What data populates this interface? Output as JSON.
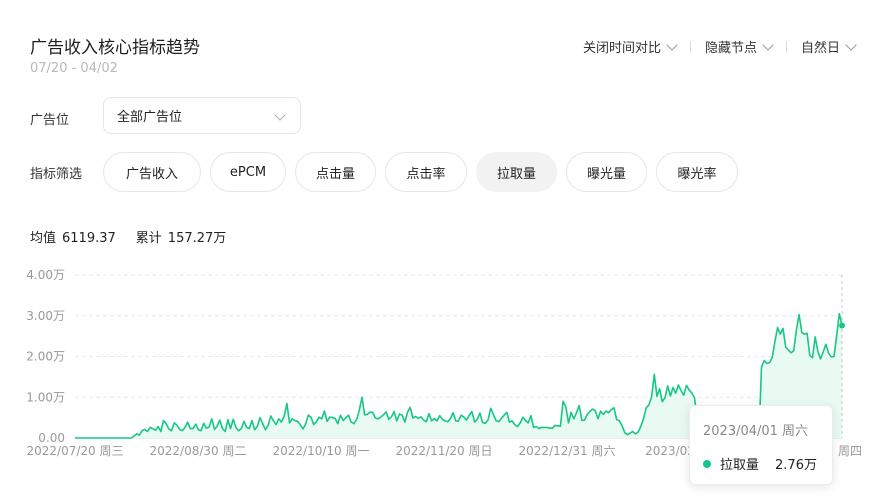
{
  "header": {
    "title": "广告收入核心指标趋势",
    "date_range": "07/20 - 04/02",
    "controls": [
      {
        "label": "关闭时间对比",
        "icon": "chevron-down-icon"
      },
      {
        "label": "隐藏节点",
        "icon": "chevron-down-icon"
      },
      {
        "label": "自然日",
        "icon": "chevron-down-icon"
      }
    ]
  },
  "filters": {
    "slot_label": "广告位",
    "slot_value": "全部广告位",
    "metric_label": "指标筛选",
    "metrics": [
      "广告收入",
      "ePCM",
      "点击量",
      "点击率",
      "拉取量",
      "曝光量",
      "曝光率"
    ],
    "active_metric": "拉取量"
  },
  "stats": {
    "avg_label": "均值",
    "avg_value": "6119.37",
    "total_label": "累计",
    "total_value": "157.27万"
  },
  "tooltip": {
    "date": "2023/04/01 周六",
    "series": "拉取量",
    "value": "2.76万"
  },
  "colors": {
    "line": "#17c784",
    "fill": "#e9faf3",
    "grid": "#e8e8e8"
  },
  "chart_data": {
    "type": "area",
    "y_tick_labels": [
      "0.00",
      "1.00万",
      "2.00万",
      "3.00万",
      "4.00万"
    ],
    "ylim": [
      0,
      40000
    ],
    "x_tick_labels": [
      "2022/07/20 周三",
      "2022/08/30 周二",
      "2022/10/10 周一",
      "2022/11/20 周日",
      "2022/12/31 周六",
      "2023/02",
      "周四"
    ],
    "x_start": "2022-07-20",
    "x_end": "2023-04-02",
    "series": [
      {
        "values": [
          0,
          0,
          0,
          0,
          0,
          0,
          0,
          0,
          0,
          0,
          0,
          0,
          0,
          0,
          0,
          0,
          0,
          0,
          0,
          0,
          0,
          0,
          500,
          1000,
          700,
          1800,
          2100,
          1600,
          2600,
          2300,
          1900,
          2800,
          1600,
          4300,
          3500,
          2200,
          1800,
          3700,
          3200,
          2100,
          1800,
          2600,
          3900,
          2300,
          2300,
          3400,
          2000,
          1800,
          3600,
          2400,
          2700,
          4700,
          2100,
          2900,
          4400,
          2300,
          1600,
          4500,
          2300,
          4600,
          2600,
          1800,
          2300,
          4100,
          2600,
          2300,
          4300,
          2000,
          2900,
          5000,
          3500,
          2000,
          3100,
          5400,
          4200,
          3300,
          4700,
          3900,
          5400,
          8500,
          3700,
          4700,
          4300,
          4100,
          3300,
          2200,
          3400,
          5600,
          5100,
          3300,
          4000,
          5100,
          4700,
          6600,
          4100,
          5100,
          5000,
          4800,
          3500,
          5600,
          4300,
          5000,
          5600,
          3900,
          3500,
          4500,
          6800,
          10000,
          5700,
          5800,
          6300,
          6300,
          4900,
          4700,
          5100,
          5700,
          6400,
          4600,
          5200,
          6500,
          4200,
          5900,
          5600,
          3900,
          6300,
          7500,
          4900,
          5300,
          4800,
          5200,
          4400,
          4000,
          6000,
          4200,
          4800,
          4200,
          5500,
          4600,
          4200,
          4000,
          4800,
          6200,
          4200,
          4200,
          5600,
          5100,
          4400,
          5600,
          6500,
          3900,
          4600,
          6100,
          3800,
          3600,
          4400,
          7300,
          5800,
          4300,
          4000,
          4800,
          5600,
          6300,
          3900,
          4200,
          3300,
          2800,
          3700,
          5100,
          4300,
          3700,
          5500,
          2600,
          2800,
          2300,
          2600,
          2600,
          2600,
          2400,
          2400,
          3100,
          3000,
          2900,
          9000,
          7700,
          3700,
          6300,
          4700,
          6200,
          8000,
          4300,
          4400,
          5800,
          6500,
          7100,
          6700,
          4700,
          6600,
          5800,
          6600,
          6200,
          7000,
          7400,
          4500,
          4200,
          3000,
          1300,
          800,
          1200,
          1600,
          1000,
          1500,
          2900,
          4700,
          7400,
          8100,
          10100,
          15600,
          10200,
          12100,
          8900,
          9900,
          12800,
          10300,
          12400,
          11000,
          13000,
          11600,
          10500,
          12900,
          11800,
          11100,
          9900,
          5000,
          3500,
          1000,
          0,
          0,
          0,
          0,
          0,
          0,
          0,
          0,
          0,
          0,
          0,
          0,
          0,
          0,
          0,
          0,
          0,
          0,
          0,
          0,
          0,
          17400,
          19000,
          18300,
          18500,
          19800,
          23800,
          27100,
          25500,
          26900,
          22300,
          21600,
          20900,
          21400,
          26500,
          30300,
          25900,
          25500,
          25700,
          20300,
          19700,
          24800,
          21200,
          19400,
          21100,
          23000,
          20800,
          19900,
          20000,
          25000,
          30500,
          27600
        ]
      }
    ]
  }
}
